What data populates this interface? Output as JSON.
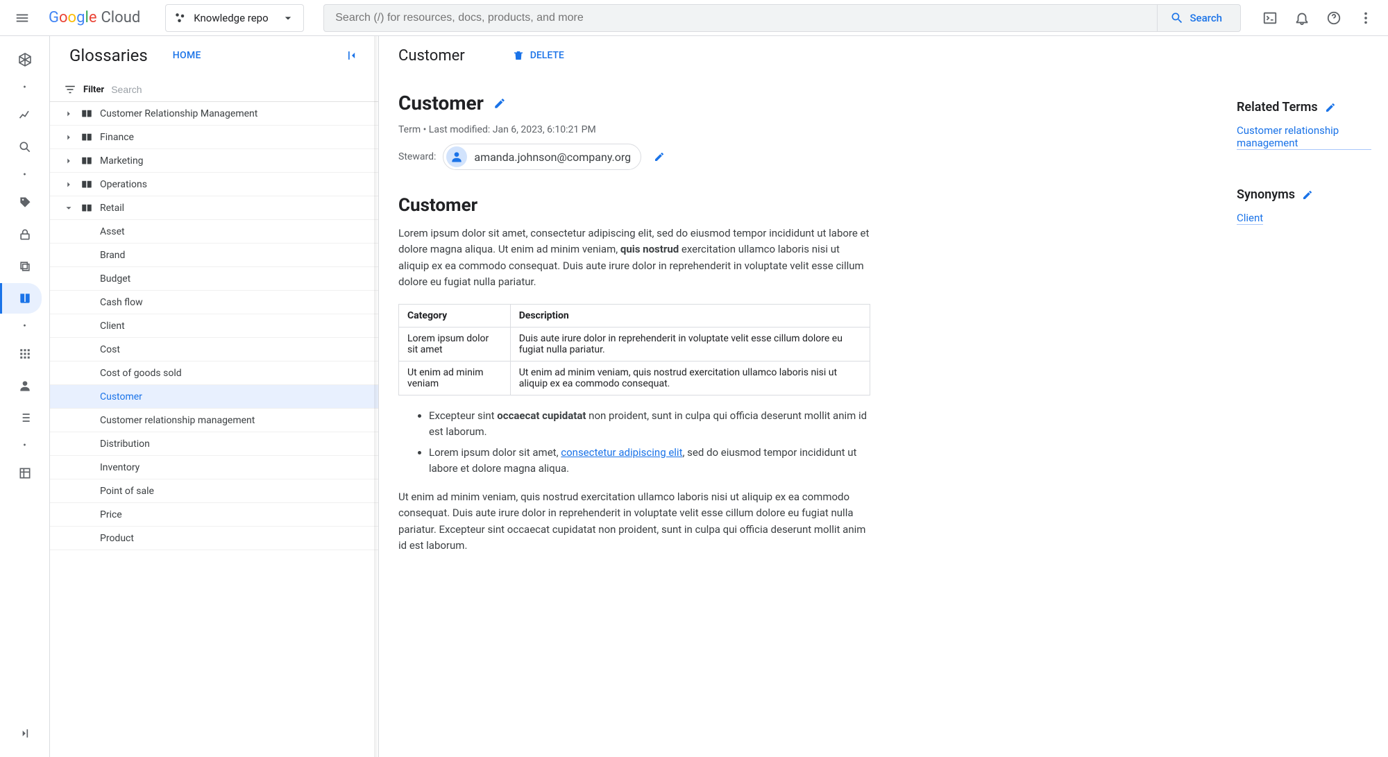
{
  "header": {
    "logo_cloud": "Cloud",
    "project_name": "Knowledge repo",
    "search_placeholder": "Search (/) for resources, docs, products, and more",
    "search_button": "Search"
  },
  "glossary": {
    "title": "Glossaries",
    "home": "HOME",
    "filter_label": "Filter",
    "filter_placeholder": "Search",
    "top_categories": [
      "Customer Relationship Management",
      "Finance",
      "Marketing",
      "Operations"
    ],
    "expanded_category": "Retail",
    "terms": [
      "Asset",
      "Brand",
      "Budget",
      "Cash flow",
      "Client",
      "Cost",
      "Cost of goods sold",
      "Customer",
      "Customer relationship management",
      "Distribution",
      "Inventory",
      "Point of sale",
      "Price",
      "Product"
    ],
    "selected_term": "Customer"
  },
  "detail": {
    "header_title": "Customer",
    "delete_label": "DELETE",
    "term_title": "Customer",
    "meta_line": "Term • Last modified: Jan 6, 2023, 6:10:21 PM",
    "steward_label": "Steward:",
    "steward_email": "amanda.johnson@company.org",
    "section_heading": "Customer",
    "para1_a": "Lorem ipsum dolor sit amet, consectetur adipiscing elit, sed do eiusmod tempor incididunt ut labore et dolore magna aliqua. Ut enim ad minim veniam, ",
    "para1_bold": "quis nostrud",
    "para1_b": " exercitation ullamco laboris nisi ut aliquip ex ea commodo consequat. Duis aute irure dolor in reprehenderit in voluptate velit esse cillum dolore eu fugiat nulla pariatur.",
    "table": {
      "h1": "Category",
      "h2": "Description",
      "r1c1": "Lorem ipsum dolor sit amet",
      "r1c2": "Duis aute irure dolor in reprehenderit in voluptate velit esse cillum dolore eu fugiat nulla pariatur.",
      "r2c1": "Ut enim ad minim veniam",
      "r2c2": "Ut enim ad minim veniam, quis nostrud exercitation ullamco laboris nisi ut aliquip ex ea commodo consequat."
    },
    "bullet1_a": "Excepteur sint ",
    "bullet1_bold": "occaecat cupidatat",
    "bullet1_b": " non proident, sunt in culpa qui officia deserunt mollit anim id est laborum.",
    "bullet2_a": "Lorem ipsum dolor sit amet, ",
    "bullet2_link": "consectetur adipiscing elit",
    "bullet2_b": ", sed do eiusmod tempor incididunt ut labore et dolore magna aliqua.",
    "para2": "Ut enim ad minim veniam, quis nostrud exercitation ullamco laboris nisi ut aliquip ex ea commodo consequat. Duis aute irure dolor in reprehenderit in voluptate velit esse cillum dolore eu fugiat nulla pariatur. Excepteur sint occaecat cupidatat non proident, sunt in culpa qui officia deserunt mollit anim id est laborum."
  },
  "side": {
    "related_title": "Related Terms",
    "related_link": "Customer relationship management",
    "synonyms_title": "Synonyms",
    "synonym_link": "Client"
  }
}
